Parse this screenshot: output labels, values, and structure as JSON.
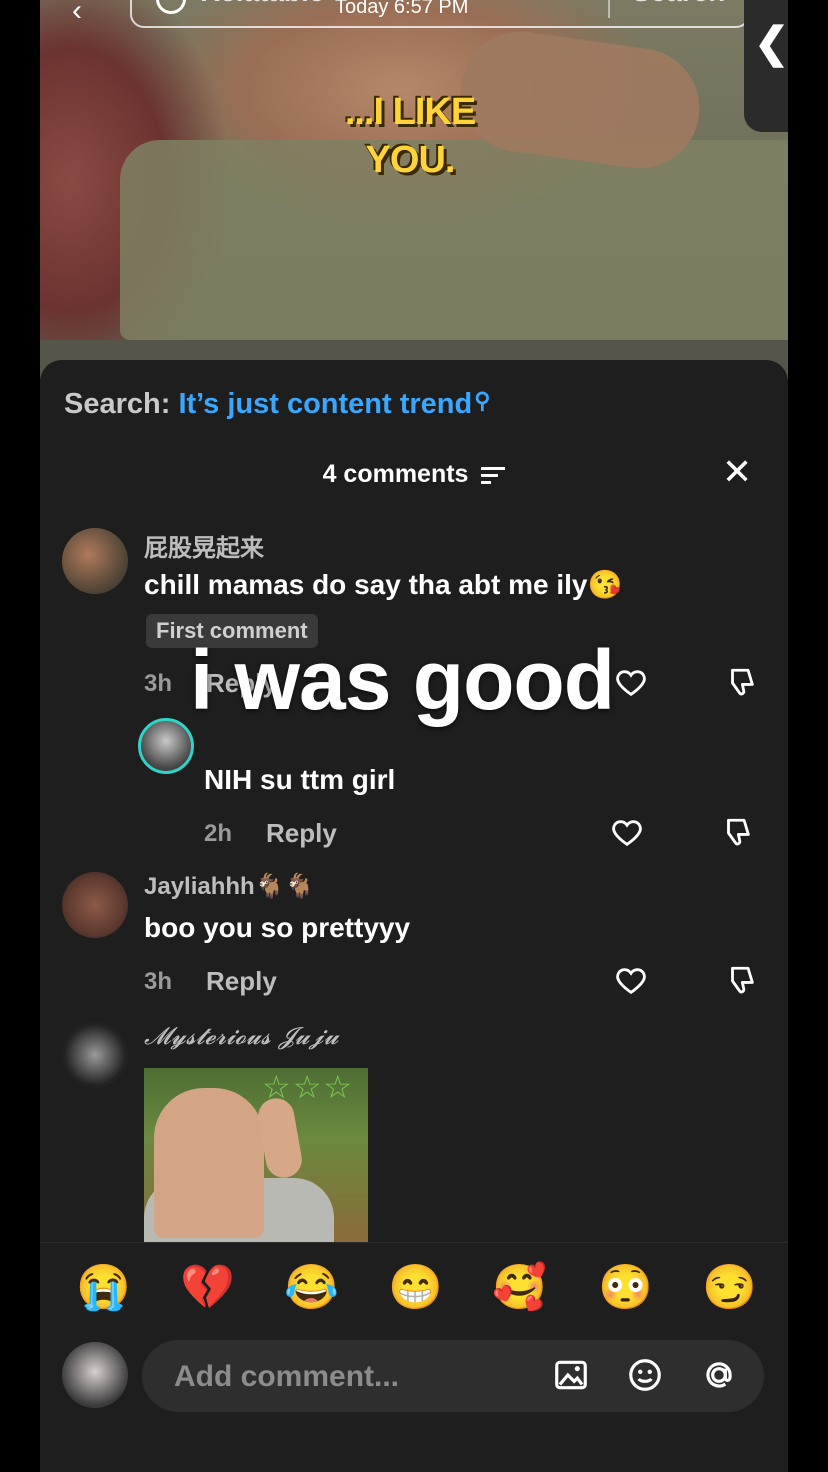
{
  "status_time": "Today 6:57 PM",
  "top_search": {
    "text": "Relatable",
    "button": "Search"
  },
  "video": {
    "caption": "...I LIKE YOU."
  },
  "search_suggestion": {
    "label": "Search:",
    "query": "It’s just content trend"
  },
  "comments_header": {
    "count_label": "4 comments"
  },
  "overlay_text": "i was good",
  "comments": [
    {
      "username": "屁股晃起来",
      "text": "chill mamas do say tha abt me ily😘",
      "badge": "First comment",
      "time": "3h",
      "reply_label": "Reply"
    },
    {
      "username": "",
      "text": "NIH su ttm girl",
      "time": "2h",
      "reply_label": "Reply"
    },
    {
      "username": "Jayliahhh🐐🐐",
      "text": "boo you so prettyyy",
      "time": "3h",
      "reply_label": "Reply"
    },
    {
      "username": "𝓜𝔂𝓼𝓽𝓮𝓻𝓲𝓸𝓾𝓼 𝓙𝓾𝓳𝓾",
      "text": ""
    }
  ],
  "emoji_bar": [
    "😭",
    "💔",
    "😂",
    "😁",
    "🥰",
    "😳",
    "😏"
  ],
  "comment_input": {
    "placeholder": "Add comment..."
  },
  "colors": {
    "sheet_bg": "#1e1e1e",
    "link": "#3aa7ff",
    "caption": "#ffd33a"
  },
  "icons": [
    "search-icon",
    "filter-icon",
    "close-icon",
    "heart-icon",
    "dislike-icon",
    "image-icon",
    "sticker-icon",
    "mention-icon"
  ]
}
